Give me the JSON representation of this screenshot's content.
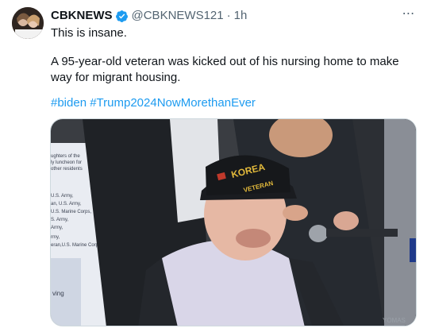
{
  "tweet": {
    "author_name": "CBKNEWS",
    "author_handle": "@CBKNEWS121",
    "separator": "·",
    "timestamp": "1h",
    "line1": "This is insane.",
    "line2": "A 95-year-old veteran was kicked out of his nursing home to make way for migrant housing.",
    "hashtag1": "#biden",
    "hashtag2": "#Trump2024NowMorethanEver",
    "more_icon": "⋯"
  },
  "media": {
    "cap_text_1": "KOREA",
    "cap_text_2": "VETERAN",
    "sign_lines": [
      "ughters of the",
      "ly luncheon for",
      "other residents",
      "U.S. Army,",
      "an, U.S. Army,",
      "U.S. Marine Corps,",
      "S. Army,",
      "Army,",
      "rmy,",
      "eran,U.S. Marine Corps,",
      "ving"
    ],
    "watermark": "YOMAS"
  },
  "colors": {
    "accent": "#1d9bf0",
    "verified_badge": "#1d9bf0",
    "secondary_text": "#536471"
  }
}
